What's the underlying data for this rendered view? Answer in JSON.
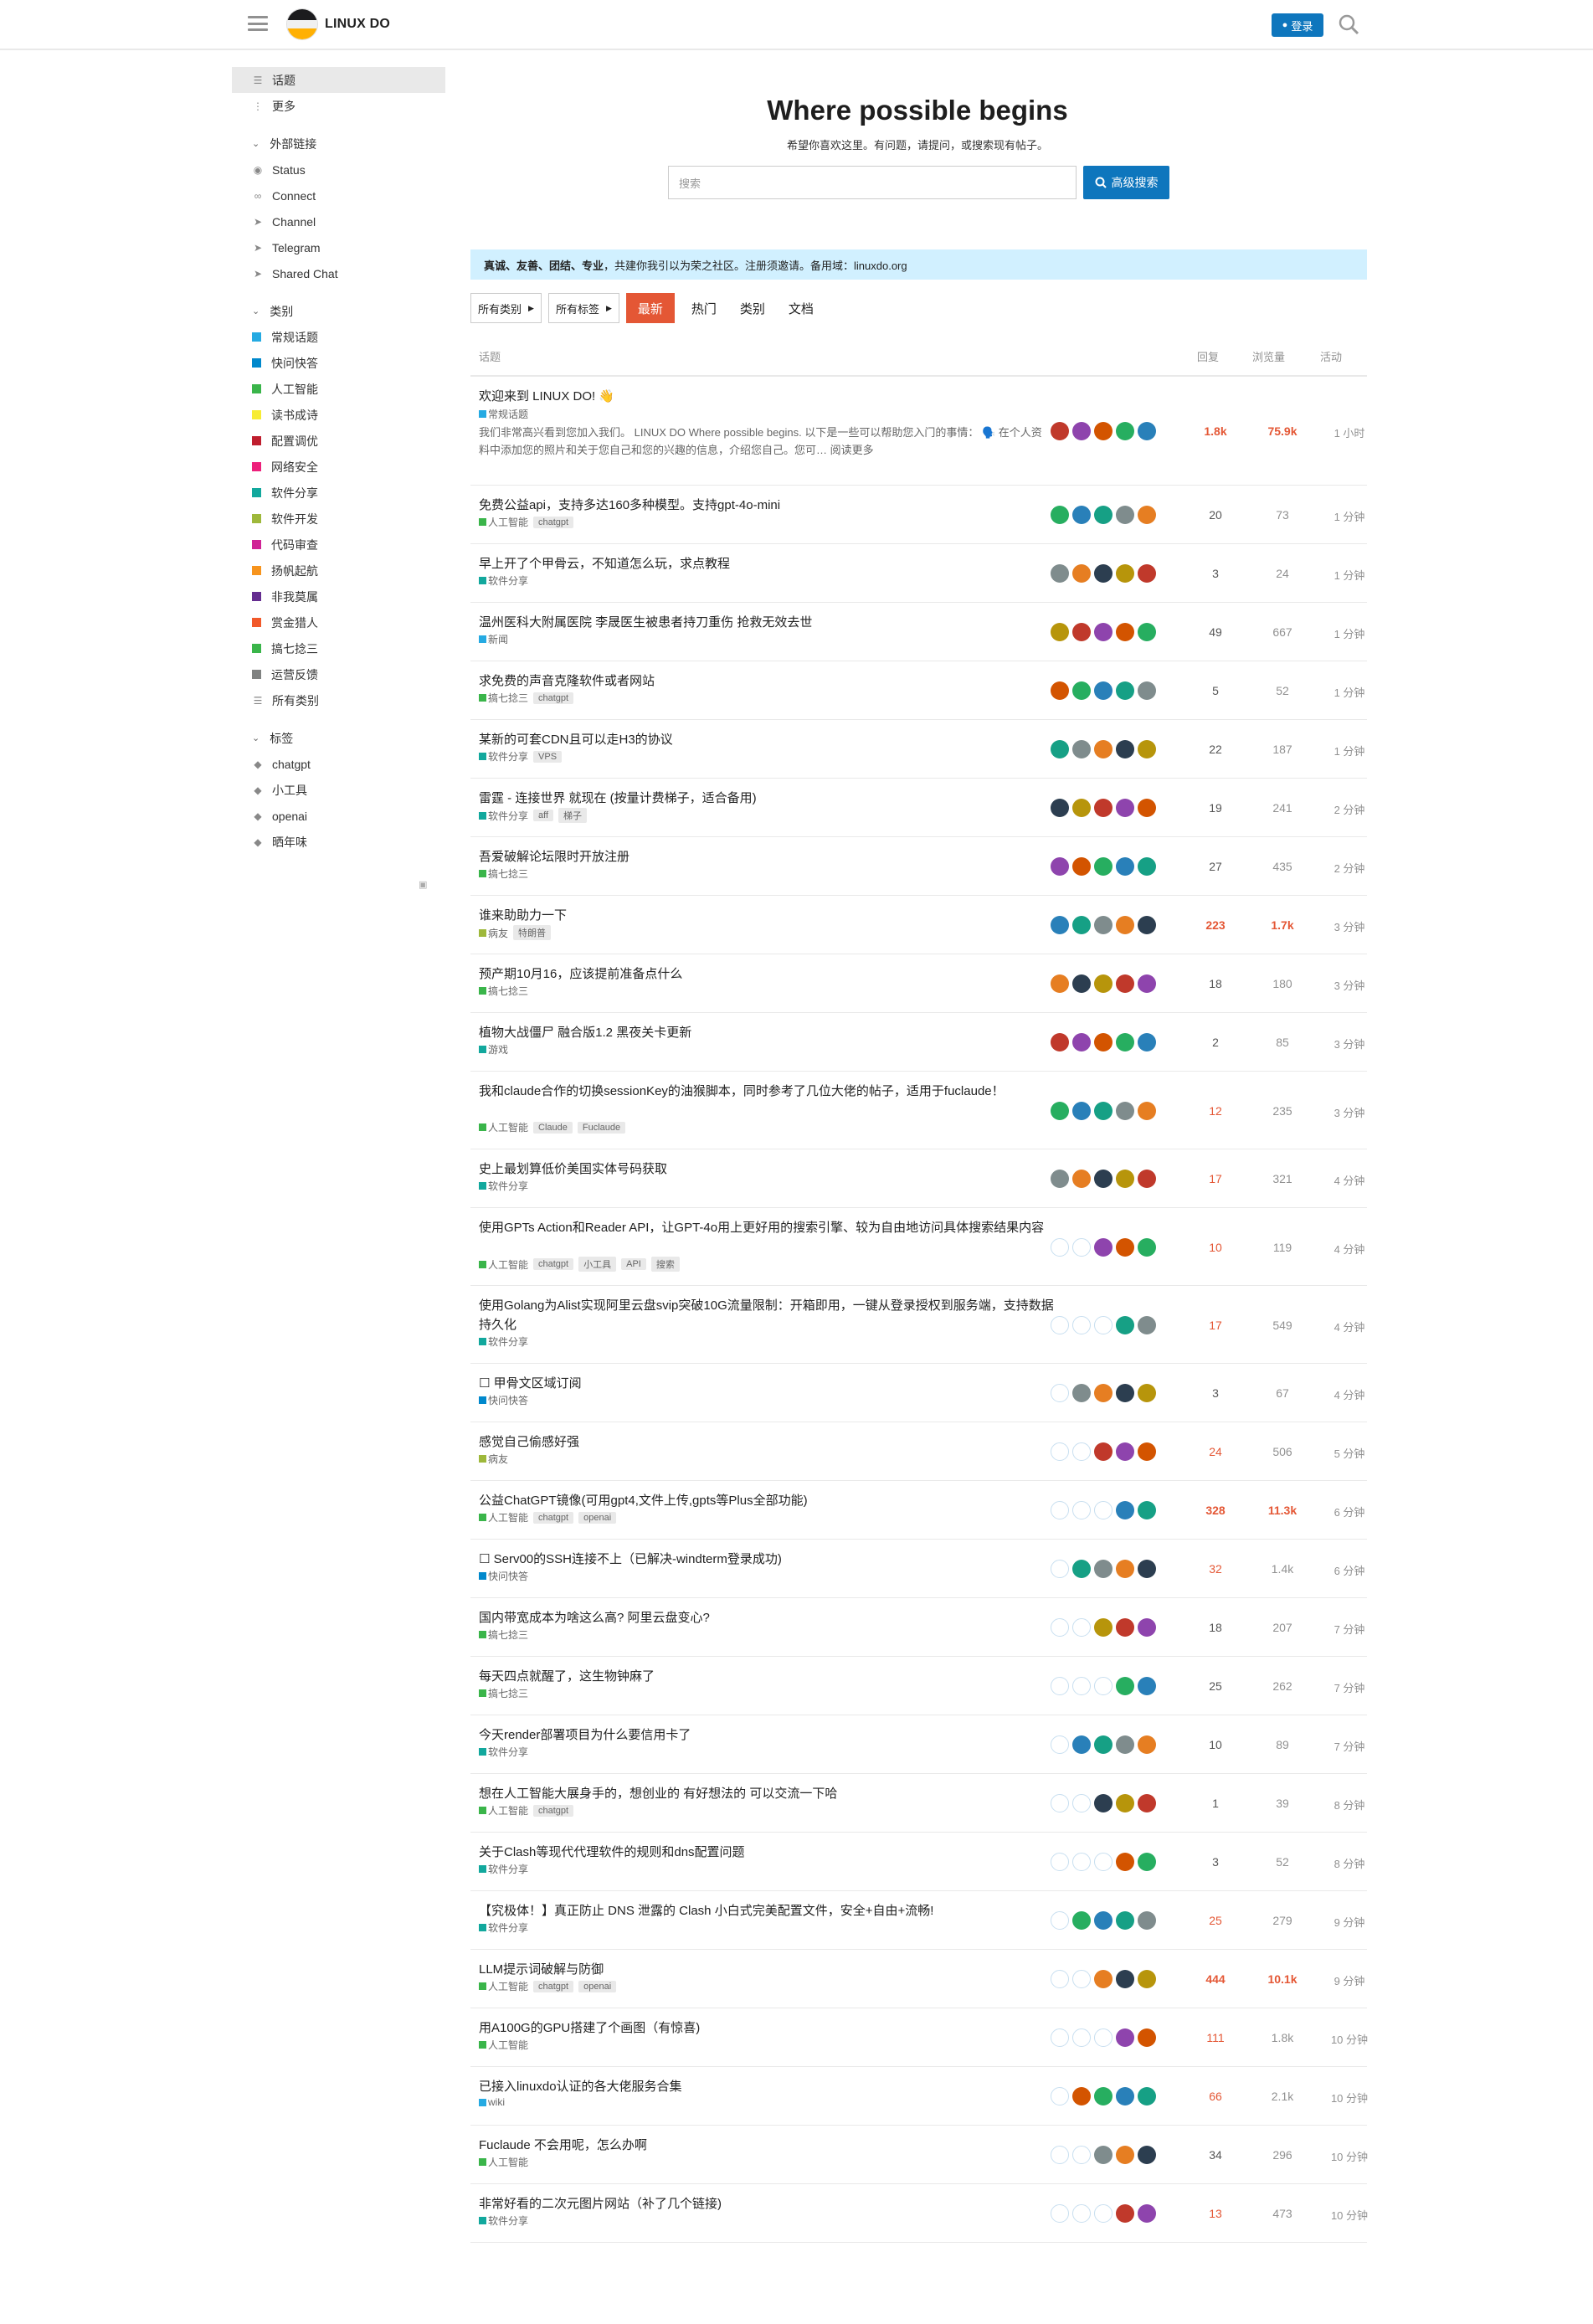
{
  "header": {
    "site_name": "LINUX DO",
    "login_label": "登录"
  },
  "sidebar": {
    "top": [
      {
        "label": "话题",
        "icon": "topics-icon"
      },
      {
        "label": "更多",
        "icon": "more-icon"
      }
    ],
    "external_heading": "外部链接",
    "external": [
      {
        "label": "Status",
        "icon": "eye-icon"
      },
      {
        "label": "Connect",
        "icon": "link-icon"
      },
      {
        "label": "Channel",
        "icon": "send-icon"
      },
      {
        "label": "Telegram",
        "icon": "send-icon"
      },
      {
        "label": "Shared Chat",
        "icon": "send-icon"
      }
    ],
    "categories_heading": "类别",
    "categories": [
      {
        "label": "常规话题",
        "color": "#25AAE2"
      },
      {
        "label": "快问快答",
        "color": "#0088CC"
      },
      {
        "label": "人工智能",
        "color": "#3AB54A"
      },
      {
        "label": "读书成诗",
        "color": "#F7EC34"
      },
      {
        "label": "配置调优",
        "color": "#BF1E2E"
      },
      {
        "label": "网络安全",
        "color": "#ED207B"
      },
      {
        "label": "软件分享",
        "color": "#12A89D"
      },
      {
        "label": "软件开发",
        "color": "#9EB83B"
      },
      {
        "label": "代码审查",
        "color": "#D02396"
      },
      {
        "label": "扬帆起航",
        "color": "#F7941D"
      },
      {
        "label": "非我莫属",
        "color": "#652D90"
      },
      {
        "label": "赏金猎人",
        "color": "#F1592A"
      },
      {
        "label": "搞七捻三",
        "color": "#3AB54A"
      },
      {
        "label": "运营反馈",
        "color": "#808281"
      },
      {
        "label": "所有类别",
        "color": ""
      }
    ],
    "tags_heading": "标签",
    "tags": [
      "chatgpt",
      "小工具",
      "openai",
      "晒年味"
    ]
  },
  "banner": {
    "title": "Where possible begins",
    "subtitle": "希望你喜欢这里。有问题，请提问，或搜索现有帖子。",
    "search_placeholder": "搜索",
    "advanced_search": "高级搜索"
  },
  "notice": {
    "bold": "真诚、友善、团结、专业",
    "text": "，共建你我引以为荣之社区。注册须邀请。备用域：linuxdo.org"
  },
  "nav": {
    "all_categories": "所有类别",
    "all_tags": "所有标签",
    "tabs": [
      "最新",
      "热门",
      "类别",
      "文档"
    ]
  },
  "table_head": {
    "topic": "话题",
    "replies": "回复",
    "views": "浏览量",
    "activity": "活动"
  },
  "topics": [
    {
      "title": "欢迎来到 LINUX DO! 👋",
      "pinned": true,
      "category": "常规话题",
      "cat_color": "#25AAE2",
      "tags": [],
      "excerpt": "我们非常高兴看到您加入我们。 LINUX DO Where possible begins. 以下是一些可以帮助您入门的事情： 🗣️ 在个人资料中添加您的照片和关于您自己和您的兴趣的信息，介绍您自己。您可… 阅读更多",
      "replies": "1.8k",
      "views": "75.9k",
      "activity": "1 小时",
      "heat": "hot"
    },
    {
      "title": "免费公益api，支持多达160多种模型。支持gpt-4o-mini",
      "category": "人工智能",
      "cat_color": "#3AB54A",
      "tags": [
        "chatgpt"
      ],
      "replies": "20",
      "views": "73",
      "activity": "1 分钟"
    },
    {
      "title": "早上开了个甲骨云，不知道怎么玩，求点教程",
      "category": "软件分享",
      "cat_color": "#12A89D",
      "tags": [],
      "replies": "3",
      "views": "24",
      "activity": "1 分钟"
    },
    {
      "title": "温州医科大附属医院 李晟医生被患者持刀重伤 抢救无效去世",
      "category": "新闻",
      "cat_color": "#25AAE2",
      "tags": [],
      "replies": "49",
      "views": "667",
      "activity": "1 分钟"
    },
    {
      "title": "求免费的声音克隆软件或者网站",
      "category": "搞七捻三",
      "cat_color": "#3AB54A",
      "tags": [
        "chatgpt"
      ],
      "replies": "5",
      "views": "52",
      "activity": "1 分钟"
    },
    {
      "title": "某新的可套CDN且可以走H3的协议",
      "category": "软件分享",
      "cat_color": "#12A89D",
      "tags": [
        "VPS"
      ],
      "replies": "22",
      "views": "187",
      "activity": "1 分钟"
    },
    {
      "title": "雷霆 - 连接世界 就现在 (按量计费梯子，适合备用)",
      "category": "软件分享",
      "cat_color": "#12A89D",
      "tags": [
        "aff",
        "梯子"
      ],
      "replies": "19",
      "views": "241",
      "activity": "2 分钟"
    },
    {
      "title": "吾爱破解论坛限时开放注册",
      "category": "搞七捻三",
      "cat_color": "#3AB54A",
      "tags": [],
      "replies": "27",
      "views": "435",
      "activity": "2 分钟"
    },
    {
      "title": "谁来助助力一下",
      "category": "病友",
      "cat_color": "#9EB83B",
      "tags": [
        "特朗普"
      ],
      "replies": "223",
      "views": "1.7k",
      "activity": "3 分钟",
      "heat": "hot"
    },
    {
      "title": "预产期10月16，应该提前准备点什么",
      "category": "搞七捻三",
      "cat_color": "#3AB54A",
      "tags": [],
      "replies": "18",
      "views": "180",
      "activity": "3 分钟"
    },
    {
      "title": "植物大战僵尸 融合版1.2 黑夜关卡更新",
      "category": "游戏",
      "cat_color": "#12A89D",
      "tags": [],
      "replies": "2",
      "views": "85",
      "activity": "3 分钟"
    },
    {
      "title": "我和claude合作的切换sessionKey的油猴脚本，同时参考了几位大佬的帖子，适用于fuclaude！",
      "category": "人工智能",
      "cat_color": "#3AB54A",
      "tags": [
        "Claude",
        "Fuclaude"
      ],
      "replies": "12",
      "views": "235",
      "activity": "3 分钟",
      "heat": "warm"
    },
    {
      "title": "史上最划算低价美国实体号码获取",
      "category": "软件分享",
      "cat_color": "#12A89D",
      "tags": [],
      "replies": "17",
      "views": "321",
      "activity": "4 分钟",
      "heat": "warm"
    },
    {
      "title": "使用GPTs Action和Reader API，让GPT-4o用上更好用的搜索引擎、较为自由地访问具体搜索结果内容",
      "category": "人工智能",
      "cat_color": "#3AB54A",
      "tags": [
        "chatgpt",
        "小工具",
        "API",
        "搜索"
      ],
      "replies": "10",
      "views": "119",
      "activity": "4 分钟",
      "heat": "warm"
    },
    {
      "title": "使用Golang为Alist实现阿里云盘svip突破10G流量限制：开箱即用，一键从登录授权到服务端，支持数据持久化",
      "category": "软件分享",
      "cat_color": "#12A89D",
      "tags": [],
      "replies": "17",
      "views": "549",
      "activity": "4 分钟",
      "heat": "warm"
    },
    {
      "title": "☐ 甲骨文区域订阅",
      "category": "快问快答",
      "cat_color": "#0088CC",
      "tags": [],
      "replies": "3",
      "views": "67",
      "activity": "4 分钟"
    },
    {
      "title": "感觉自己偷感好强",
      "category": "病友",
      "cat_color": "#9EB83B",
      "tags": [],
      "replies": "24",
      "views": "506",
      "activity": "5 分钟",
      "heat": "warm"
    },
    {
      "title": "公益ChatGPT镜像(可用gpt4,文件上传,gpts等Plus全部功能)",
      "category": "人工智能",
      "cat_color": "#3AB54A",
      "tags": [
        "chatgpt",
        "openai"
      ],
      "replies": "328",
      "views": "11.3k",
      "activity": "6 分钟",
      "heat": "hot"
    },
    {
      "title": "☐ Serv00的SSH连接不上（已解决-windterm登录成功)",
      "category": "快问快答",
      "cat_color": "#0088CC",
      "tags": [],
      "replies": "32",
      "views": "1.4k",
      "activity": "6 分钟",
      "heat": "warm"
    },
    {
      "title": "国内带宽成本为啥这么高? 阿里云盘变心?",
      "category": "搞七捻三",
      "cat_color": "#3AB54A",
      "tags": [],
      "replies": "18",
      "views": "207",
      "activity": "7 分钟"
    },
    {
      "title": "每天四点就醒了，这生物钟麻了",
      "category": "搞七捻三",
      "cat_color": "#3AB54A",
      "tags": [],
      "replies": "25",
      "views": "262",
      "activity": "7 分钟"
    },
    {
      "title": "今天render部署项目为什么要信用卡了",
      "category": "软件分享",
      "cat_color": "#12A89D",
      "tags": [],
      "replies": "10",
      "views": "89",
      "activity": "7 分钟"
    },
    {
      "title": "想在人工智能大展身手的，想创业的 有好想法的 可以交流一下哈",
      "category": "人工智能",
      "cat_color": "#3AB54A",
      "tags": [
        "chatgpt"
      ],
      "replies": "1",
      "views": "39",
      "activity": "8 分钟"
    },
    {
      "title": "关于Clash等现代代理软件的规则和dns配置问题",
      "category": "软件分享",
      "cat_color": "#12A89D",
      "tags": [],
      "replies": "3",
      "views": "52",
      "activity": "8 分钟"
    },
    {
      "title": "【究极体！】真正防止 DNS 泄露的 Clash 小白式完美配置文件，安全+自由+流畅!",
      "category": "软件分享",
      "cat_color": "#12A89D",
      "tags": [],
      "replies": "25",
      "views": "279",
      "activity": "9 分钟",
      "heat": "warm"
    },
    {
      "title": "LLM提示词破解与防御",
      "category": "人工智能",
      "cat_color": "#3AB54A",
      "tags": [
        "chatgpt",
        "openai"
      ],
      "replies": "444",
      "views": "10.1k",
      "activity": "9 分钟",
      "heat": "hot"
    },
    {
      "title": "用A100G的GPU搭建了个画图（有惊喜)",
      "category": "人工智能",
      "cat_color": "#3AB54A",
      "tags": [],
      "replies": "111",
      "views": "1.8k",
      "activity": "10 分钟",
      "heat": "warm"
    },
    {
      "title": "已接入linuxdo认证的各大佬服务合集",
      "category": "wiki",
      "cat_color": "#25AAE2",
      "tags": [],
      "replies": "66",
      "views": "2.1k",
      "activity": "10 分钟",
      "heat": "warm"
    },
    {
      "title": "Fuclaude 不会用呢，怎么办啊",
      "category": "人工智能",
      "cat_color": "#3AB54A",
      "tags": [],
      "replies": "34",
      "views": "296",
      "activity": "10 分钟"
    },
    {
      "title": "非常好看的二次元图片网站（补了几个链接)",
      "category": "软件分享",
      "cat_color": "#12A89D",
      "tags": [],
      "replies": "13",
      "views": "473",
      "activity": "10 分钟",
      "heat": "warm"
    }
  ]
}
